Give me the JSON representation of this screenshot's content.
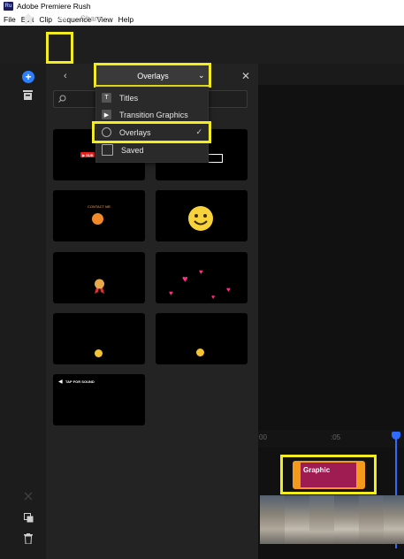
{
  "app": {
    "title": "Adobe Premiere Rush",
    "icon_text": "Ru"
  },
  "menubar": [
    "File",
    "Edit",
    "Clip",
    "Sequence",
    "View",
    "Help"
  ],
  "nav": {
    "edit": "Edit",
    "share": "Share"
  },
  "panel": {
    "dropdown_value": "Overlays",
    "menu_items": [
      {
        "label": "Titles",
        "icon": "titles-icon",
        "checked": false
      },
      {
        "label": "Transition Graphics",
        "icon": "transition-graphics-icon",
        "checked": false
      },
      {
        "label": "Overlays",
        "icon": "overlays-icon",
        "checked": true
      },
      {
        "label": "Saved",
        "icon": "saved-icon",
        "checked": false
      }
    ],
    "check_mark": "✓"
  },
  "tiles": {
    "tile1_caption": "▶ SUB",
    "tile3_caption": "CONTACT ME",
    "tile9_caption": "TAP FOR SOUND"
  },
  "timeline": {
    "tick_0": "00",
    "tick_1": ":05",
    "clip_label": "Graphic"
  },
  "colors": {
    "accent_blue": "#2b7fff",
    "highlight_yellow": "#f2ec20",
    "clip_orange": "#f39a1d",
    "clip_magenta": "#9e1c52"
  }
}
